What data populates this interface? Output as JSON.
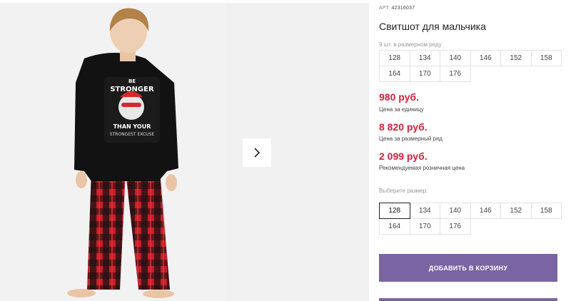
{
  "product": {
    "art_label": "АРТ.",
    "art_number": "42316037",
    "title": "Свитшот для мальчика",
    "row_count": "9 шт. в размерном ряду",
    "row_sizes": [
      "128",
      "134",
      "140",
      "146",
      "152",
      "158",
      "164",
      "170",
      "176"
    ],
    "prices": [
      {
        "value": "980 руб.",
        "label": "Цена за единицу"
      },
      {
        "value": "8 820 руб.",
        "label": "Цена за размерный ряд"
      },
      {
        "value": "2 099 руб.",
        "label": "Рекомендуемая розничная цена"
      }
    ],
    "choose_size_label": "Выберите размер:",
    "choose_sizes": [
      "128",
      "134",
      "140",
      "146",
      "152",
      "158",
      "164",
      "170",
      "176"
    ],
    "selected_size": "128",
    "add_to_cart": "ДОБАВИТЬ В КОРЗИНУ"
  },
  "gallery": {
    "next_icon": "chevron-right-icon",
    "shirt_print": [
      "BE",
      "STRONGER",
      "THAN YOUR",
      "STRONGEST EXCUSE"
    ]
  },
  "colors": {
    "price": "#d4213d",
    "button": "#7b64a2"
  }
}
